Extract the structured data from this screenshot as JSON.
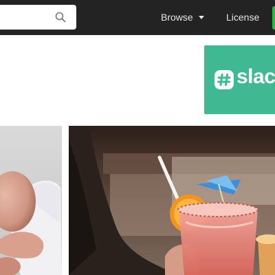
{
  "header": {
    "search": {
      "value": "",
      "placeholder": ""
    },
    "search_icon": "search-icon",
    "nav": {
      "browse_label": "Browse",
      "license_label": "License"
    },
    "colors": {
      "bar": "#232323",
      "nav_text": "#e6e6e6",
      "cta": "#2fb34a"
    }
  },
  "ad": {
    "brand": "slack",
    "logo_icon": "slack-logo-icon",
    "background": "#3eb991"
  },
  "gallery": {
    "photos": [
      {
        "name": "sleeping baby in white clothes"
      },
      {
        "name": "pink cocktail with paper umbrella and orange slice"
      }
    ]
  }
}
